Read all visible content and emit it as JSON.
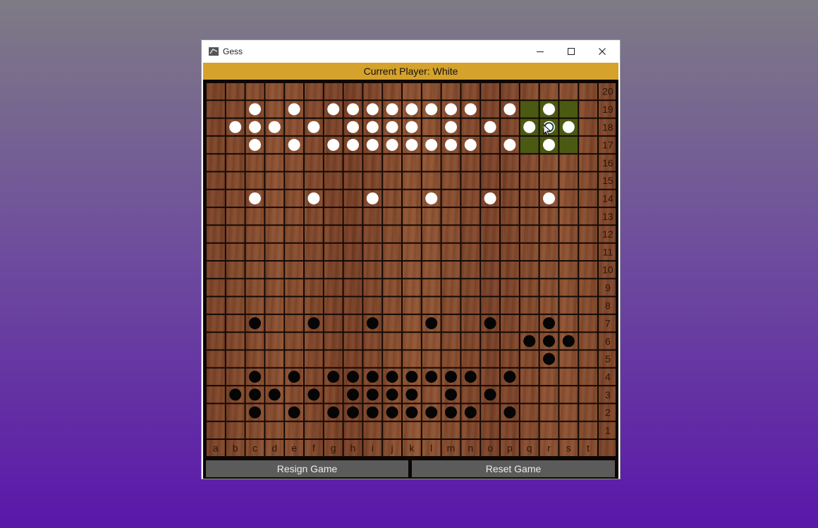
{
  "window": {
    "title": "Gess",
    "controls": [
      "minimize",
      "maximize",
      "close"
    ]
  },
  "status": {
    "text": "Current Player: White"
  },
  "board": {
    "columns": [
      "a",
      "b",
      "c",
      "d",
      "e",
      "f",
      "g",
      "h",
      "i",
      "j",
      "k",
      "l",
      "m",
      "n",
      "o",
      "p",
      "q",
      "r",
      "s",
      "t"
    ],
    "rows": [
      "20",
      "19",
      "18",
      "17",
      "16",
      "15",
      "14",
      "13",
      "12",
      "11",
      "10",
      "9",
      "8",
      "7",
      "6",
      "5",
      "4",
      "3",
      "2",
      "1"
    ],
    "white_stones": [
      "c19",
      "e19",
      "g19",
      "h19",
      "i19",
      "j19",
      "k19",
      "l19",
      "m19",
      "n19",
      "p19",
      "r19",
      "b18",
      "c18",
      "d18",
      "f18",
      "h18",
      "i18",
      "j18",
      "k18",
      "m18",
      "o18",
      "q18",
      "r18",
      "s18",
      "c17",
      "e17",
      "g17",
      "h17",
      "i17",
      "j17",
      "k17",
      "l17",
      "m17",
      "n17",
      "p17",
      "r17",
      "c14",
      "f14",
      "i14",
      "l14",
      "o14",
      "r14"
    ],
    "black_stones": [
      "c7",
      "f7",
      "i7",
      "l7",
      "o7",
      "r7",
      "q6",
      "r6",
      "s6",
      "r5",
      "c4",
      "e4",
      "g4",
      "h4",
      "i4",
      "j4",
      "k4",
      "l4",
      "m4",
      "n4",
      "p4",
      "b3",
      "c3",
      "d3",
      "f3",
      "h3",
      "i3",
      "j3",
      "k3",
      "m3",
      "o3",
      "c2",
      "e2",
      "g2",
      "h2",
      "i2",
      "j2",
      "k2",
      "l2",
      "m2",
      "n2",
      "p2"
    ],
    "selected_piece": {
      "center": "r18",
      "squares": [
        "q19",
        "r19",
        "s19",
        "q18",
        "r18",
        "s18",
        "q17",
        "r17",
        "s17"
      ],
      "highlight_color": "#4b5a12"
    },
    "colors": {
      "white_stone": "#ffffff",
      "black_stone": "#050505",
      "grid_line": "#140905",
      "label": "#2a140a"
    }
  },
  "buttons": {
    "resign": "Resign Game",
    "reset": "Reset Game"
  }
}
